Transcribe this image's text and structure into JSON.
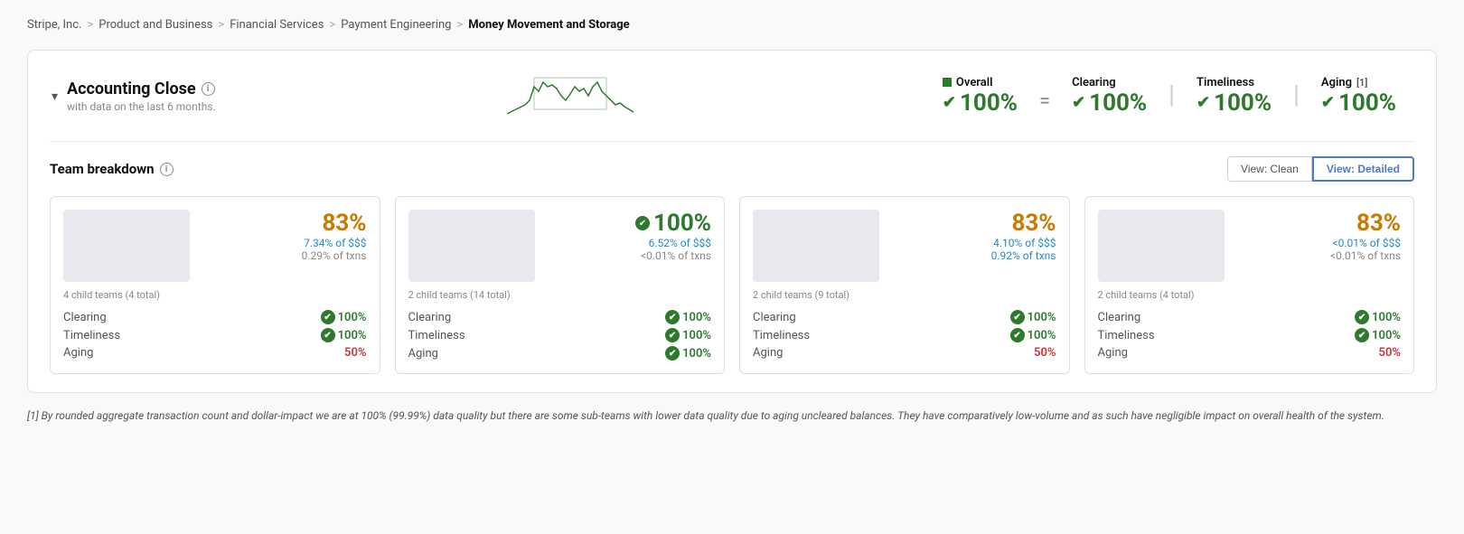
{
  "breadcrumb": {
    "items": [
      {
        "label": "Stripe, Inc.",
        "active": false
      },
      {
        "label": "Product and Business",
        "active": false
      },
      {
        "label": "Financial Services",
        "active": false
      },
      {
        "label": "Payment Engineering",
        "active": false
      },
      {
        "label": "Money Movement and Storage",
        "active": true
      }
    ],
    "separators": [
      ">",
      ">",
      ">",
      ">"
    ]
  },
  "section": {
    "title": "Accounting Close",
    "info_icon": "i",
    "subtitle": "with data on the last 6 months.",
    "collapse_icon": "▾"
  },
  "overall": {
    "label": "Overall",
    "value": "100%",
    "check": "✔",
    "equals": "=",
    "metrics": [
      {
        "label": "Clearing",
        "value": "100%",
        "check": "✔"
      },
      {
        "label": "Timeliness",
        "value": "100%",
        "check": "✔"
      },
      {
        "label": "Aging",
        "value": "100%",
        "sup": "[1]",
        "check": "✔"
      }
    ]
  },
  "team_breakdown": {
    "title": "Team breakdown",
    "view_clean_label": "View: Clean",
    "view_detailed_label": "View: Detailed",
    "active_view": "detailed",
    "cards": [
      {
        "pct": "83%",
        "pct_type": "orange",
        "sub1": "7.34% of $$$",
        "sub2": "0.29% of txns",
        "sub2_type": "normal",
        "child_label": "4 child teams (4 total)",
        "metrics": [
          {
            "label": "Clearing",
            "value": "100%",
            "type": "green",
            "check": true
          },
          {
            "label": "Timeliness",
            "value": "100%",
            "type": "green",
            "check": true
          },
          {
            "label": "Aging",
            "value": "50%",
            "type": "red",
            "check": false
          }
        ]
      },
      {
        "pct": "100%",
        "pct_type": "green",
        "sub1": "6.52% of $$$",
        "sub2": "<0.01% of txns",
        "sub2_type": "normal",
        "child_label": "2 child teams (14 total)",
        "metrics": [
          {
            "label": "Clearing",
            "value": "100%",
            "type": "green",
            "check": true
          },
          {
            "label": "Timeliness",
            "value": "100%",
            "type": "green",
            "check": true
          },
          {
            "label": "Aging",
            "value": "100%",
            "type": "green",
            "check": true
          }
        ]
      },
      {
        "pct": "83%",
        "pct_type": "orange",
        "sub1": "4.10% of $$$",
        "sub2": "0.92% of txns",
        "sub2_type": "blue",
        "child_label": "2 child teams (9 total)",
        "metrics": [
          {
            "label": "Clearing",
            "value": "100%",
            "type": "green",
            "check": true
          },
          {
            "label": "Timeliness",
            "value": "100%",
            "type": "green",
            "check": true
          },
          {
            "label": "Aging",
            "value": "50%",
            "type": "red",
            "check": false
          }
        ]
      },
      {
        "pct": "83%",
        "pct_type": "orange",
        "sub1": "<0.01% of $$$",
        "sub2": "<0.01% of txns",
        "sub2_type": "normal",
        "child_label": "2 child teams (4 total)",
        "metrics": [
          {
            "label": "Clearing",
            "value": "100%",
            "type": "green",
            "check": true
          },
          {
            "label": "Timeliness",
            "value": "100%",
            "type": "green",
            "check": true
          },
          {
            "label": "Aging",
            "value": "50%",
            "type": "red",
            "check": false
          }
        ]
      }
    ]
  },
  "footnote": "[1] By rounded aggregate transaction count and dollar-impact we are at 100% (99.99%) data quality but there are some sub-teams with lower data quality due to aging uncleared balances.\nThey have comparatively low-volume and as such have negligible impact on overall health of the system."
}
